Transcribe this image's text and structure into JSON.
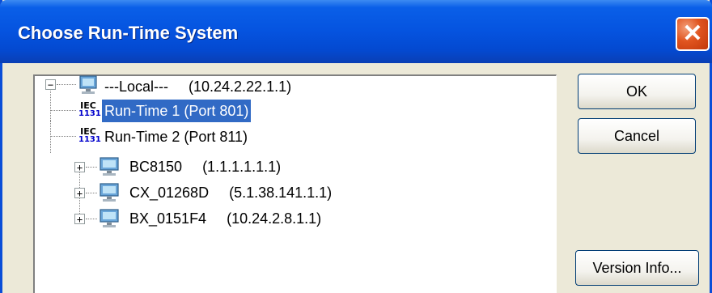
{
  "dialog": {
    "title": "Choose Run-Time System",
    "close_glyph": "✕"
  },
  "tree": {
    "root": {
      "name": "---Local---",
      "address": "(10.24.2.22.1.1)",
      "expander": "−"
    },
    "runtimes": [
      {
        "name": "Run-Time 1 (Port 801)",
        "selected": true,
        "icon_top": "IEC",
        "icon_bottom": "1131"
      },
      {
        "name": "Run-Time 2 (Port 811)",
        "selected": false,
        "icon_top": "IEC",
        "icon_bottom": "1131"
      }
    ],
    "targets": [
      {
        "name": "BC8150",
        "address": "(1.1.1.1.1.1)",
        "expander": "+"
      },
      {
        "name": "CX_01268D",
        "address": "(5.1.38.141.1.1)",
        "expander": "+"
      },
      {
        "name": "BX_0151F4",
        "address": "(10.24.2.8.1.1)",
        "expander": "+"
      }
    ]
  },
  "buttons": {
    "ok": "OK",
    "cancel": "Cancel",
    "version_info": "Version Info..."
  },
  "colors": {
    "title_bar": "#0553df",
    "selection": "#316ac5",
    "close_button": "#e0541f",
    "dialog_face": "#ece9d8"
  }
}
